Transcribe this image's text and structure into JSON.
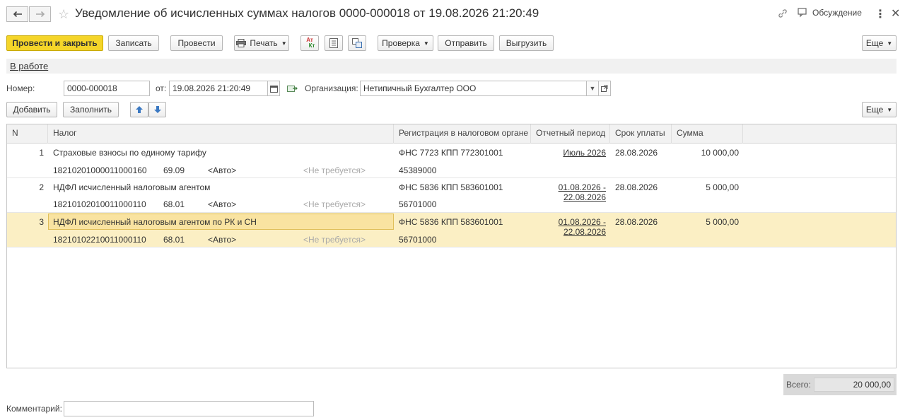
{
  "window": {
    "title": "Уведомление об исчисленных суммах налогов 0000-000018 от 19.08.2026 21:20:49",
    "discussion_label": "Обсуждение"
  },
  "toolbar": {
    "post_and_close": "Провести и закрыть",
    "save": "Записать",
    "post": "Провести",
    "print": "Печать",
    "check": "Проверка",
    "send": "Отправить",
    "upload": "Выгрузить",
    "more": "Еще",
    "dt_kt_line1": "Ат",
    "dt_kt_line2": "Кт"
  },
  "status": {
    "link": "В работе"
  },
  "form": {
    "number_label": "Номер:",
    "number_value": "0000-000018",
    "date_label": "от:",
    "date_value": "19.08.2026 21:20:49",
    "org_label": "Организация:",
    "org_value": "Нетипичный Бухгалтер ООО"
  },
  "table_toolbar": {
    "add": "Добавить",
    "fill": "Заполнить",
    "more": "Еще"
  },
  "table": {
    "columns": [
      "N",
      "Налог",
      "Регистрация в налоговом органе",
      "Отчетный период",
      "Срок уплаты",
      "Сумма"
    ],
    "rows": [
      {
        "n": "1",
        "tax": "Страховые взносы по единому тарифу",
        "kbk": "18210201000011000160",
        "account": "69.09",
        "auto": "<Авто>",
        "not_required": "<Не требуется>",
        "registration": "ФНС 7723 КПП 772301001",
        "oktmo": "45389000",
        "period_line1": "Июль 2026",
        "period_line2": "",
        "due": "28.08.2026",
        "sum": "10 000,00"
      },
      {
        "n": "2",
        "tax": "НДФЛ исчисленный налоговым агентом",
        "kbk": "18210102010011000110",
        "account": "68.01",
        "auto": "<Авто>",
        "not_required": "<Не требуется>",
        "registration": "ФНС 5836 КПП 583601001",
        "oktmo": "56701000",
        "period_line1": "01.08.2026 -",
        "period_line2": "22.08.2026",
        "due": "28.08.2026",
        "sum": "5 000,00"
      },
      {
        "n": "3",
        "tax": "НДФЛ исчисленный налоговым агентом по РК и СН",
        "kbk": "18210102210011000110",
        "account": "68.01",
        "auto": "<Авто>",
        "not_required": "<Не требуется>",
        "registration": "ФНС 5836 КПП 583601001",
        "oktmo": "56701000",
        "period_line1": "01.08.2026 -",
        "period_line2": "22.08.2026",
        "due": "28.08.2026",
        "sum": "5 000,00"
      }
    ]
  },
  "footer": {
    "total_label": "Всего:",
    "total_value": "20 000,00",
    "comment_label": "Комментарий:",
    "comment_value": ""
  },
  "colors": {
    "primary_button": "#f5d529",
    "selected_row": "#fbefc4"
  }
}
